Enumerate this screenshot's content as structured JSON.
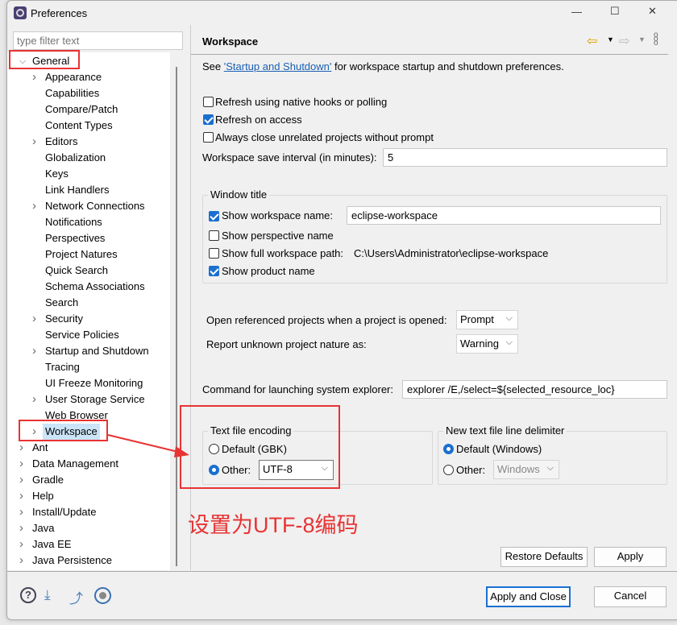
{
  "window": {
    "title": "Preferences",
    "controls": [
      "—",
      "☐",
      "✕"
    ]
  },
  "filter": {
    "placeholder": "type filter text"
  },
  "tree": [
    {
      "label": "General",
      "level": 0,
      "expanded": true
    },
    {
      "label": "Appearance",
      "level": 1,
      "children": true
    },
    {
      "label": "Capabilities",
      "level": 1
    },
    {
      "label": "Compare/Patch",
      "level": 1
    },
    {
      "label": "Content Types",
      "level": 1
    },
    {
      "label": "Editors",
      "level": 1,
      "children": true
    },
    {
      "label": "Globalization",
      "level": 1
    },
    {
      "label": "Keys",
      "level": 1
    },
    {
      "label": "Link Handlers",
      "level": 1
    },
    {
      "label": "Network Connections",
      "level": 1,
      "children": true
    },
    {
      "label": "Notifications",
      "level": 1
    },
    {
      "label": "Perspectives",
      "level": 1
    },
    {
      "label": "Project Natures",
      "level": 1
    },
    {
      "label": "Quick Search",
      "level": 1
    },
    {
      "label": "Schema Associations",
      "level": 1
    },
    {
      "label": "Search",
      "level": 1
    },
    {
      "label": "Security",
      "level": 1,
      "children": true
    },
    {
      "label": "Service Policies",
      "level": 1
    },
    {
      "label": "Startup and Shutdown",
      "level": 1,
      "children": true
    },
    {
      "label": "Tracing",
      "level": 1
    },
    {
      "label": "UI Freeze Monitoring",
      "level": 1
    },
    {
      "label": "User Storage Service",
      "level": 1,
      "children": true
    },
    {
      "label": "Web Browser",
      "level": 1
    },
    {
      "label": "Workspace",
      "level": 1,
      "children": true,
      "selected": true
    },
    {
      "label": "Ant",
      "level": 0,
      "children": true
    },
    {
      "label": "Data Management",
      "level": 0,
      "children": true
    },
    {
      "label": "Gradle",
      "level": 0,
      "children": true
    },
    {
      "label": "Help",
      "level": 0,
      "children": true
    },
    {
      "label": "Install/Update",
      "level": 0,
      "children": true
    },
    {
      "label": "Java",
      "level": 0,
      "children": true
    },
    {
      "label": "Java EE",
      "level": 0,
      "children": true
    },
    {
      "label": "Java Persistence",
      "level": 0,
      "children": true
    }
  ],
  "page": {
    "title": "Workspace",
    "intro_prefix": "See ",
    "intro_link": "'Startup and Shutdown'",
    "intro_suffix": " for workspace startup and shutdown preferences.",
    "refresh_native": {
      "label": "Refresh using native hooks or polling",
      "checked": false
    },
    "refresh_access": {
      "label": "Refresh on access",
      "checked": true
    },
    "always_close": {
      "label": "Always close unrelated projects without prompt",
      "checked": false
    },
    "save_interval": {
      "label": "Workspace save interval (in minutes):",
      "value": "5"
    },
    "window_title": {
      "legend": "Window title",
      "show_ws_name": {
        "label": "Show workspace name:",
        "checked": true,
        "value": "eclipse-workspace"
      },
      "show_perspective": {
        "label": "Show perspective name",
        "checked": false
      },
      "show_full_path": {
        "label": "Show full workspace path:",
        "checked": false,
        "value": "C:\\Users\\Administrator\\eclipse-workspace"
      },
      "show_product": {
        "label": "Show product name",
        "checked": true
      }
    },
    "open_ref": {
      "label": "Open referenced projects when a project is opened:",
      "value": "Prompt"
    },
    "report_nature": {
      "label": "Report unknown project nature as:",
      "value": "Warning"
    },
    "explorer": {
      "label": "Command for launching system explorer:",
      "value": "explorer /E,/select=${selected_resource_loc}"
    },
    "encoding": {
      "legend": "Text file encoding",
      "default_label": "Default (GBK)",
      "other_label": "Other:",
      "other_value": "UTF-8",
      "selected": "other"
    },
    "delimiter": {
      "legend": "New text file line delimiter",
      "default_label": "Default (Windows)",
      "other_label": "Other:",
      "other_value": "Windows",
      "selected": "default"
    },
    "restore_defaults": "Restore Defaults",
    "apply": "Apply"
  },
  "annotation": {
    "text": "设置为UTF-8编码",
    "color": "#e83333"
  },
  "footer": {
    "apply_close": "Apply and Close",
    "cancel": "Cancel"
  }
}
